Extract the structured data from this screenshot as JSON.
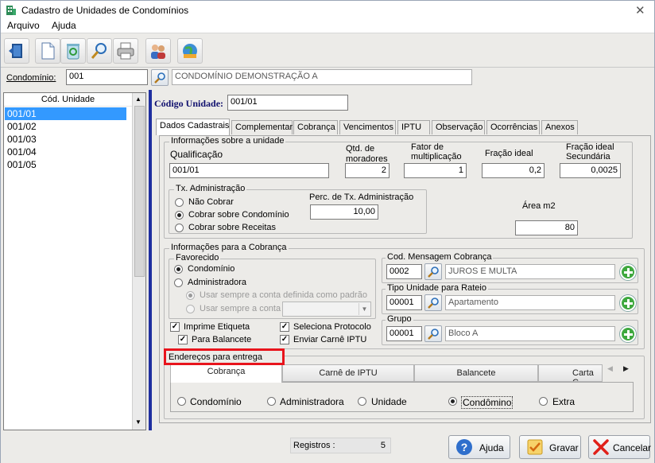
{
  "window": {
    "title": "Cadastro de Unidades de Condomínios"
  },
  "menu": {
    "items": [
      "Arquivo",
      "Ajuda"
    ]
  },
  "condominio": {
    "label": "Condomínio:",
    "code": "001",
    "name": "CONDOMÍNIO DEMONSTRAÇÃO A"
  },
  "unit_list": {
    "header": "Cód. Unidade",
    "items": [
      "001/01",
      "001/02",
      "001/03",
      "001/04",
      "001/05"
    ]
  },
  "codigo_unidade": {
    "label": "Código Unidade:",
    "value": "001/01"
  },
  "tabs": [
    "Dados Cadastrais",
    "Complementar",
    "Cobrança",
    "Vencimentos",
    "IPTU",
    "Observação",
    "Ocorrências",
    "Anexos"
  ],
  "info_unidade": {
    "title": "Informações sobre a unidade",
    "qualificacao_label": "Qualificação",
    "qualificacao": "001/01",
    "qtd_moradores_label": "Qtd. de moradores",
    "qtd_moradores": "2",
    "fator_label": "Fator de multiplicação",
    "fator": "1",
    "fracao_ideal_label": "Fração ideal",
    "fracao_ideal": "0,2",
    "fracao_sec_label": "Fração ideal Secundária",
    "fracao_sec": "0,0025",
    "tx_title": "Tx. Administração",
    "tx_options": [
      "Não Cobrar",
      "Cobrar sobre Condomínio",
      "Cobrar sobre Receitas"
    ],
    "perc_label": "Perc. de Tx. Administração",
    "perc": "10,00",
    "area_label": "Área m2",
    "area": "80"
  },
  "info_cobranca": {
    "title": "Informações para a Cobrança",
    "favorecido_title": "Favorecido",
    "favorecido_options": [
      "Condomínio",
      "Administradora"
    ],
    "conta_options": [
      "Usar sempre a conta definida como padrão",
      "Usar sempre a conta"
    ],
    "checks": {
      "imprime_etiqueta": "Imprime Etiqueta",
      "para_balancete": "Para Balancete",
      "seleciona_protocolo": "Seleciona Protocolo",
      "enviar_carne": "Enviar Carnê IPTU"
    },
    "cod_mensagem": {
      "label": "Cod. Mensagem Cobrança",
      "code": "0002",
      "desc": "JUROS E MULTA"
    },
    "tipo_unidade": {
      "label": "Tipo Unidade para Rateio",
      "code": "00001",
      "desc": "Apartamento"
    },
    "grupo": {
      "label": "Grupo",
      "code": "00001",
      "desc": "Bloco A"
    }
  },
  "enderecos": {
    "title": "Endereços para entrega",
    "tabs": [
      "Cobrança",
      "Carnê de IPTU",
      "Balancete",
      "Carta C"
    ],
    "options": [
      "Condomínio",
      "Administradora",
      "Unidade",
      "Condômino",
      "Extra"
    ]
  },
  "status": {
    "registros_label": "Registros :",
    "registros": "5"
  },
  "buttons": {
    "ajuda": "Ajuda",
    "gravar": "Gravar",
    "cancelar": "Cancelar"
  },
  "colors": {
    "highlight_box": "#e8141c",
    "selection": "#3399ff",
    "label_blue": "#10106e"
  }
}
